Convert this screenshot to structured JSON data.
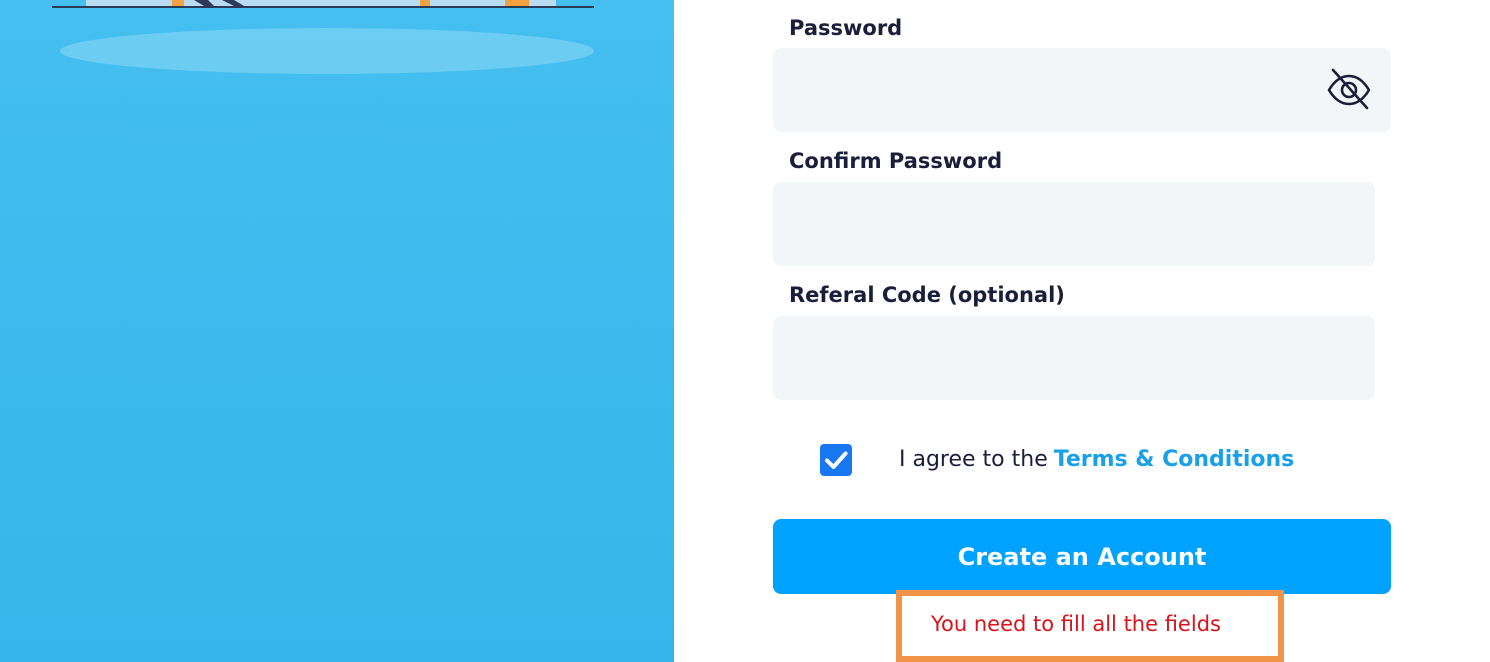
{
  "form": {
    "password": {
      "label": "Password",
      "value": "",
      "placeholder": ""
    },
    "confirm_password": {
      "label": "Confirm Password",
      "value": "",
      "placeholder": ""
    },
    "referral_code": {
      "label": "Referal Code (optional)",
      "value": "",
      "placeholder": ""
    },
    "terms": {
      "checked": true,
      "prefix": "I agree to the",
      "link_text": "Terms & Conditions"
    },
    "submit_label": "Create an Account",
    "error_message": "You need to fill all the fields"
  },
  "icons": {
    "password_toggle": "eye-off-icon",
    "checkbox": "checkmark-icon"
  },
  "colors": {
    "left_panel": "#3dbbee",
    "primary_button": "#00a2ff",
    "link": "#1aa0e8",
    "error_text": "#d8131b",
    "error_border": "#f19447",
    "checkbox": "#1778f2",
    "field_bg": "#f3f6f9"
  }
}
